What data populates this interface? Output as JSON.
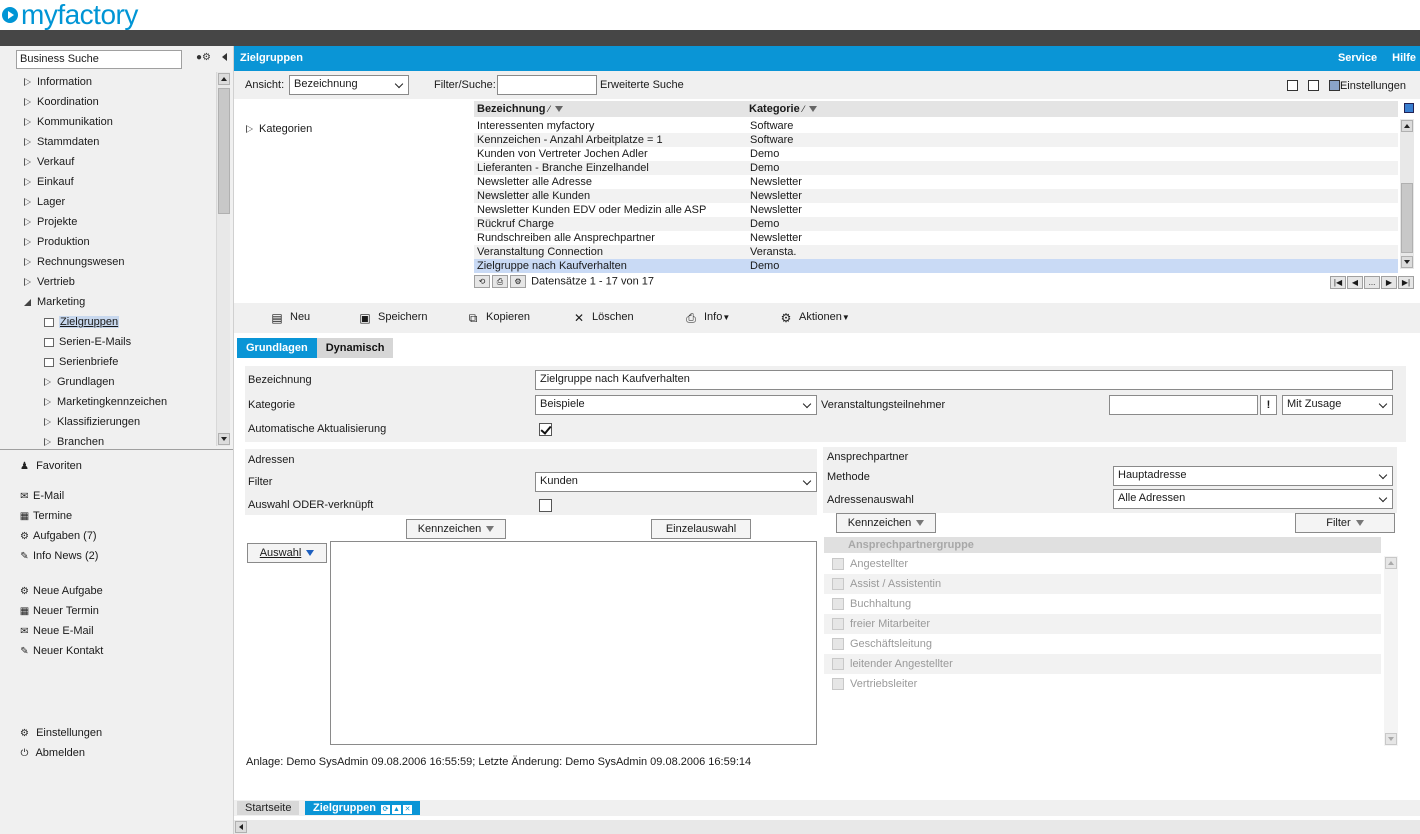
{
  "brand": {
    "logo_text": "myfactory"
  },
  "sidebar": {
    "search_value": "Business Suche",
    "tree": [
      {
        "label": "Information",
        "level": 0,
        "state": "closed"
      },
      {
        "label": "Koordination",
        "level": 0,
        "state": "closed"
      },
      {
        "label": "Kommunikation",
        "level": 0,
        "state": "closed"
      },
      {
        "label": "Stammdaten",
        "level": 0,
        "state": "closed"
      },
      {
        "label": "Verkauf",
        "level": 0,
        "state": "closed"
      },
      {
        "label": "Einkauf",
        "level": 0,
        "state": "closed"
      },
      {
        "label": "Lager",
        "level": 0,
        "state": "closed"
      },
      {
        "label": "Projekte",
        "level": 0,
        "state": "closed"
      },
      {
        "label": "Produktion",
        "level": 0,
        "state": "closed"
      },
      {
        "label": "Rechnungswesen",
        "level": 0,
        "state": "closed"
      },
      {
        "label": "Vertrieb",
        "level": 0,
        "state": "closed"
      },
      {
        "label": "Marketing",
        "level": 0,
        "state": "open"
      },
      {
        "label": "Zielgruppen",
        "level": 1,
        "state": "doc",
        "selected": true
      },
      {
        "label": "Serien-E-Mails",
        "level": 1,
        "state": "doc"
      },
      {
        "label": "Serienbriefe",
        "level": 1,
        "state": "doc"
      },
      {
        "label": "Grundlagen",
        "level": 1,
        "state": "closed"
      },
      {
        "label": "Marketingkennzeichen",
        "level": 1,
        "state": "closed"
      },
      {
        "label": "Klassifizierungen",
        "level": 1,
        "state": "closed"
      },
      {
        "label": "Branchen",
        "level": 1,
        "state": "closed"
      }
    ],
    "favoriten": "Favoriten",
    "links1": [
      {
        "icon": "✉",
        "label": "E-Mail"
      },
      {
        "icon": "▦",
        "label": "Termine"
      },
      {
        "icon": "⚙",
        "label": "Aufgaben (7)"
      },
      {
        "icon": "✎",
        "label": "Info News (2)"
      }
    ],
    "links2": [
      {
        "icon": "⚙",
        "label": "Neue Aufgabe"
      },
      {
        "icon": "▦",
        "label": "Neuer Termin"
      },
      {
        "icon": "✉",
        "label": "Neue E-Mail"
      },
      {
        "icon": "✎",
        "label": "Neuer Kontakt"
      }
    ],
    "einstellungen": "Einstellungen",
    "abmelden": "Abmelden"
  },
  "header": {
    "title": "Zielgruppen",
    "service": "Service",
    "hilfe": "Hilfe"
  },
  "filter": {
    "ansicht_label": "Ansicht:",
    "ansicht_value": "Bezeichnung",
    "filter_label": "Filter/Suche:",
    "filter_value": "",
    "erweitert": "Erweiterte Suche",
    "einstellungen": "Einstellungen"
  },
  "kategorien_label": "Kategorien",
  "grid": {
    "col1": "Bezeichnung",
    "col2": "Kategorie",
    "rows": [
      {
        "name": "Interessenten myfactory",
        "cat": "Software"
      },
      {
        "name": "Kennzeichen - Anzahl Arbeitplatze = 1",
        "cat": "Software"
      },
      {
        "name": "Kunden von Vertreter Jochen Adler",
        "cat": "Demo"
      },
      {
        "name": "Lieferanten - Branche Einzelhandel",
        "cat": "Demo"
      },
      {
        "name": "Newsletter alle Adresse",
        "cat": "Newsletter"
      },
      {
        "name": "Newsletter alle Kunden",
        "cat": "Newsletter"
      },
      {
        "name": "Newsletter Kunden EDV oder Medizin alle ASP",
        "cat": "Newsletter"
      },
      {
        "name": "Rückruf Charge",
        "cat": "Demo"
      },
      {
        "name": "Rundschreiben alle Ansprechpartner",
        "cat": "Newsletter"
      },
      {
        "name": "Veranstaltung Connection",
        "cat": "Veransta."
      },
      {
        "name": "Zielgruppe nach Kaufverhalten",
        "cat": "Demo",
        "selected": true
      }
    ],
    "records": "Datensätze 1 - 17 von 17",
    "pager_more": "..."
  },
  "toolbar": {
    "neu": "Neu",
    "speichern": "Speichern",
    "kopieren": "Kopieren",
    "loeschen": "Löschen",
    "info": "Info",
    "aktionen": "Aktionen"
  },
  "tabs": {
    "grundlagen": "Grundlagen",
    "dynamisch": "Dynamisch"
  },
  "form": {
    "bezeichnung_label": "Bezeichnung",
    "bezeichnung_value": "Zielgruppe nach Kaufverhalten",
    "kategorie_label": "Kategorie",
    "kategorie_value": "Beispiele",
    "veranst_label": "Veranstaltungsteilnehmer",
    "veranst_value": "",
    "excl": "!",
    "zusage_value": "Mit Zusage",
    "auto_label": "Automatische Aktualisierung",
    "auto_checked": true
  },
  "adressen": {
    "title": "Adressen",
    "filter_label": "Filter",
    "filter_value": "Kunden",
    "oder_label": "Auswahl ODER-verknüpft",
    "oder_checked": false,
    "kennzeichen_btn": "Kennzeichen",
    "einzel_btn": "Einzelauswahl",
    "auswahl_btn": "Auswahl"
  },
  "ansprechpartner": {
    "title": "Ansprechpartner",
    "methode_label": "Methode",
    "methode_value": "Hauptadresse",
    "adressauswahl_label": "Adressenauswahl",
    "adressauswahl_value": "Alle Adressen",
    "kennzeichen_btn": "Kennzeichen",
    "filter_btn": "Filter",
    "group_head": "Ansprechpartnergruppe",
    "groups": [
      "Angestellter",
      "Assist / Assistentin",
      "Buchhaltung",
      "freier Mitarbeiter",
      "Geschäftsleitung",
      "leitender Angestellter",
      "Vertriebsleiter"
    ]
  },
  "status_line": "Anlage: Demo SysAdmin 09.08.2006 16:55:59; Letzte Änderung: Demo SysAdmin 09.08.2006 16:59:14",
  "bottom_tabs": {
    "startseite": "Startseite",
    "zielgruppen": "Zielgruppen"
  },
  "colors": {
    "accent": "#0a95d6",
    "dark_bar": "#464646",
    "panel": "#f0f0f0",
    "selected_row": "#c9daf5"
  }
}
